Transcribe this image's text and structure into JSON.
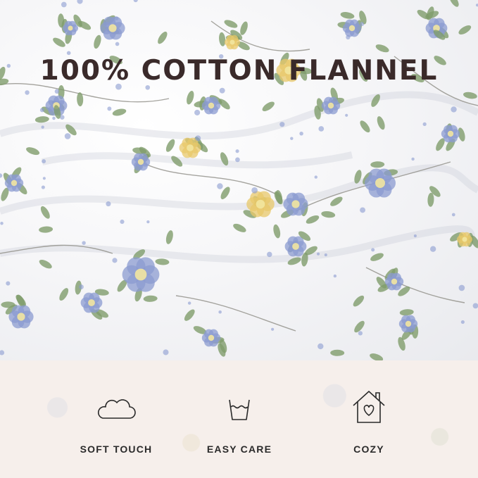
{
  "title": "100% COTTON FLANNEL",
  "features": [
    {
      "label": "SOFT TOUCH",
      "icon": "cloud-icon"
    },
    {
      "label": "EASY CARE",
      "icon": "wash-basin-icon"
    },
    {
      "label": "COZY",
      "icon": "house-heart-icon"
    }
  ],
  "colors": {
    "title": "#3a2a2a",
    "band": "#f6efeb",
    "flower_blue": "#8b9bd0",
    "flower_yellow": "#e8c86a",
    "leaf": "#7f9c6c"
  }
}
